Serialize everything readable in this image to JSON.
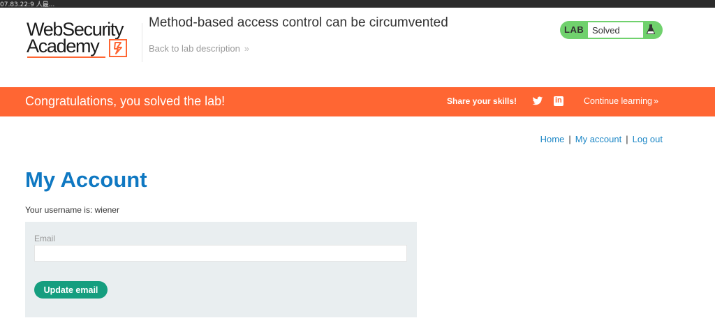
{
  "browser": {
    "strip_text": "07.83.22:9 人最..."
  },
  "header": {
    "logo_line1": "WebSecurity",
    "logo_line2": "Academy",
    "lab_title": "Method-based access control can be circumvented",
    "back_link": "Back to lab description",
    "back_chevron": "»",
    "status_label": "LAB",
    "status_value": "Solved"
  },
  "banner": {
    "message": "Congratulations, you solved the lab!",
    "share_label": "Share your skills!",
    "continue_label": "Continue learning",
    "continue_chevron": "»",
    "linkedin_glyph": "in"
  },
  "nav": {
    "home": "Home",
    "my_account": "My account",
    "log_out": "Log out",
    "separator": "|"
  },
  "main": {
    "title": "My Account",
    "username_text": "Your username is: wiener",
    "email_label": "Email",
    "email_value": "",
    "update_button": "Update email"
  },
  "icons": {
    "logo_bolt": "lightning-bolt-icon",
    "status": "flask-icon",
    "twitter": "twitter-icon",
    "linkedin": "linkedin-icon"
  },
  "colors": {
    "accent_orange": "#ff6633",
    "link_blue": "#1d87c6",
    "title_blue": "#0f78c2",
    "status_green": "#70d16d",
    "button_green": "#159e7f"
  }
}
